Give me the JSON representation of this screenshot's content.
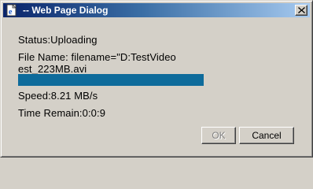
{
  "window": {
    "title": "-- Web Page Dialog",
    "icon": "ie-page-icon",
    "close_label": "close"
  },
  "status": {
    "line": "Status:Uploading"
  },
  "file": {
    "line1": "File Name: filename=\"D:TestVideo",
    "line2": "est_223MB.avi"
  },
  "progress": {
    "fraction": 1.0,
    "color": "#0e6b9b"
  },
  "speed": {
    "line": "Speed:8.21 MB/s"
  },
  "time": {
    "line": "Time Remain:0:0:9"
  },
  "buttons": {
    "ok_label": "OK",
    "ok_enabled": false,
    "cancel_label": "Cancel"
  }
}
